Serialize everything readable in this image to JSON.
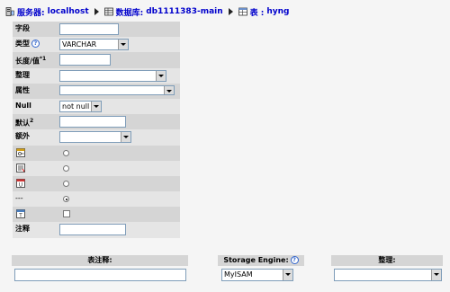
{
  "breadcrumb": {
    "server_label": "服务器:",
    "server_value": "localhost",
    "database_label": "数据库:",
    "database_value": "db1111383-main",
    "table_label": "表 :",
    "table_value": "hyng"
  },
  "fields": {
    "field_label": "字段",
    "field_value": "",
    "type_label": "类型",
    "type_value": "VARCHAR",
    "length_label": "长度/值",
    "length_sup": "*1",
    "length_value": "",
    "collation_label": "整理",
    "collation_value": "",
    "attributes_label": "属性",
    "attributes_value": "",
    "null_label": "Null",
    "null_value": "not null",
    "default_label": "默认",
    "default_sup": "2",
    "default_value": "",
    "extra_label": "额外",
    "extra_value": "",
    "index_none_label": "---",
    "comment_label": "注释",
    "comment_value": ""
  },
  "key_options": [
    {
      "name": "primary",
      "icon": "primary-key-icon",
      "selected": false
    },
    {
      "name": "index",
      "icon": "index-icon",
      "selected": false
    },
    {
      "name": "unique",
      "icon": "unique-icon",
      "selected": false
    },
    {
      "name": "none",
      "icon": "",
      "selected": true
    }
  ],
  "fulltext": {
    "icon": "fulltext-icon",
    "checked": false
  },
  "table_options": {
    "comment_label": "表注释:",
    "comment_value": "",
    "engine_label": "Storage Engine:",
    "engine_value": "MyISAM",
    "collation_label": "整理:",
    "collation_value": ""
  },
  "colors": {
    "link": "#0000cc",
    "row_dark": "#d5d5d5",
    "row_light": "#e5e5e5",
    "background": "#f5f5f5"
  }
}
